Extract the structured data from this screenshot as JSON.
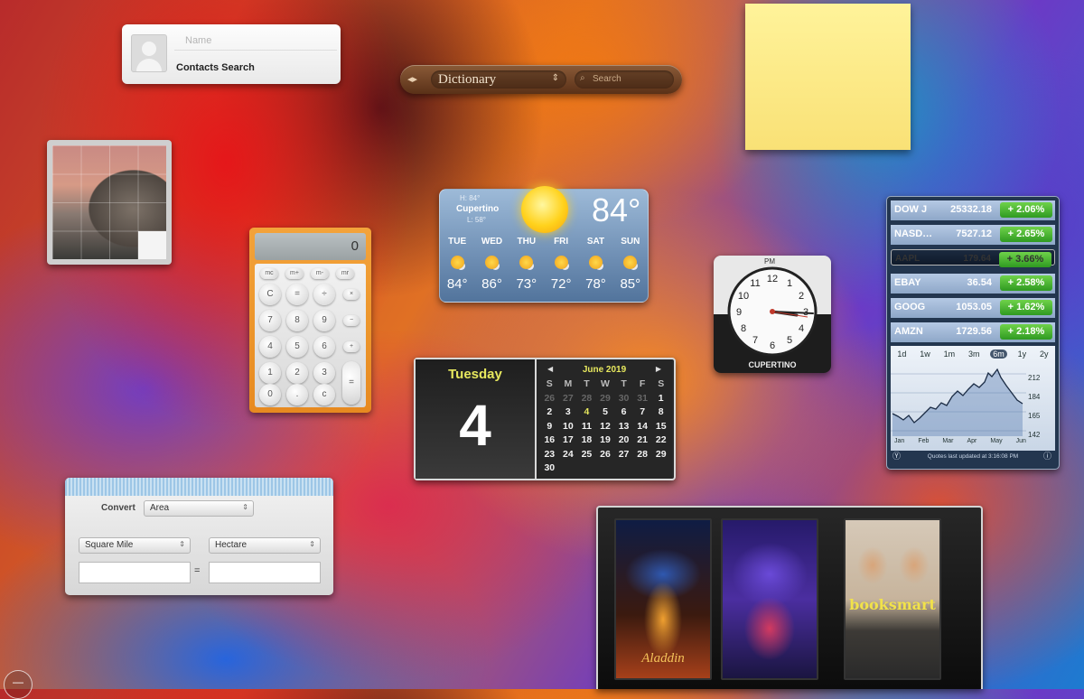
{
  "contacts": {
    "name_placeholder": "Name",
    "label": "Contacts Search"
  },
  "dictionary": {
    "source": "Dictionary",
    "search_placeholder": "Search"
  },
  "calculator": {
    "display": "0",
    "mem_keys": [
      "mc",
      "m+",
      "m-",
      "mr"
    ]
  },
  "weather": {
    "city": "Cupertino",
    "hi": "H: 84°",
    "lo": "L: 58°",
    "current_temp": "84°",
    "forecast": [
      {
        "day": "TUE",
        "temp": "84°"
      },
      {
        "day": "WED",
        "temp": "86°"
      },
      {
        "day": "THU",
        "temp": "73°"
      },
      {
        "day": "FRI",
        "temp": "72°"
      },
      {
        "day": "SAT",
        "temp": "78°"
      },
      {
        "day": "SUN",
        "temp": "85°"
      }
    ]
  },
  "clock": {
    "ampm": "PM",
    "city": "CUPERTINO"
  },
  "calendar": {
    "weekday": "Tuesday",
    "day": "4",
    "month": "June 2019",
    "dow": [
      "S",
      "M",
      "T",
      "W",
      "T",
      "F",
      "S"
    ],
    "days": [
      "26",
      "27",
      "28",
      "29",
      "30",
      "31",
      "1",
      "2",
      "3",
      "4",
      "5",
      "6",
      "7",
      "8",
      "9",
      "10",
      "11",
      "12",
      "13",
      "14",
      "15",
      "16",
      "17",
      "18",
      "19",
      "20",
      "21",
      "22",
      "23",
      "24",
      "25",
      "26",
      "27",
      "28",
      "29",
      "30"
    ]
  },
  "stocks": {
    "rows": [
      {
        "symbol": "DOW J",
        "price": "25332.18",
        "change": "+ 2.06%"
      },
      {
        "symbol": "NASD…",
        "price": "7527.12",
        "change": "+ 2.65%"
      },
      {
        "symbol": "AAPL",
        "price": "179.64",
        "change": "+ 3.66%"
      },
      {
        "symbol": "EBAY",
        "price": "36.54",
        "change": "+ 2.58%"
      },
      {
        "symbol": "GOOG",
        "price": "1053.05",
        "change": "+ 1.62%"
      },
      {
        "symbol": "AMZN",
        "price": "1729.56",
        "change": "+ 2.18%"
      }
    ],
    "ranges": [
      "1d",
      "1w",
      "1m",
      "3m",
      "6m",
      "1y",
      "2y"
    ],
    "selected_range": "6m",
    "y_ticks": [
      "212",
      "184",
      "165",
      "142"
    ],
    "months": [
      "Jan",
      "Feb",
      "Mar",
      "Apr",
      "May",
      "Jun"
    ],
    "footer": "Quotes last updated at 3:16:08 PM",
    "change_color": "#3fae2a"
  },
  "converter": {
    "convert_label": "Convert",
    "category": "Area",
    "from_unit": "Square Mile",
    "to_unit": "Hectare",
    "equals": "="
  },
  "movies": {
    "posters": [
      {
        "title": "Aladdin"
      },
      {
        "title": ""
      },
      {
        "title": "booksmart"
      }
    ]
  },
  "dock": {
    "menu_glyph": "—"
  }
}
